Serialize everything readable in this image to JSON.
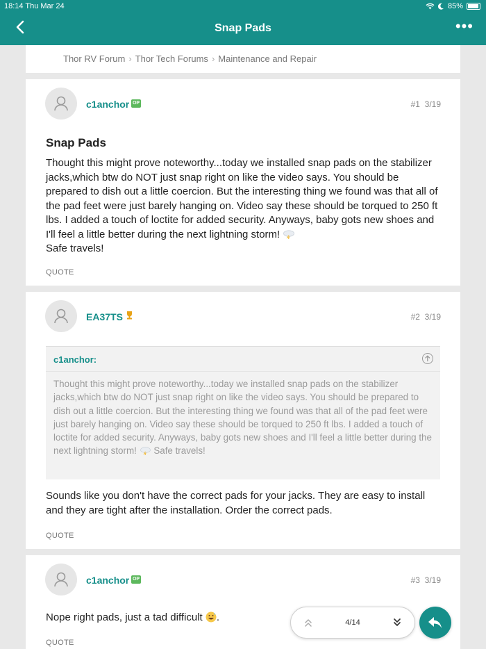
{
  "status": {
    "time_date": "18:14  Thu Mar 24",
    "battery": "85%"
  },
  "nav": {
    "title": "Snap Pads"
  },
  "breadcrumb": [
    "Thor RV Forum",
    "Thor Tech Forums",
    "Maintenance and Repair"
  ],
  "posts": [
    {
      "username": "c1anchor",
      "badge": "OP",
      "number": "#1",
      "date": "3/19",
      "title": "Snap Pads",
      "body": "Thought this might prove noteworthy...today we installed snap pads on the stabilizer jacks,which btw do NOT just snap right on like the video says. You should be prepared to dish out a little coercion. But the interesting thing we found was that all of the pad feet were just barely hanging on. Video say these should be torqued to 250 ft lbs. I added a touch of loctite for added security. Anyways, baby gots new shoes and I'll feel a little better during the next lightning storm!",
      "body_end": "Safe travels!",
      "quote_label": "QUOTE"
    },
    {
      "username": "EA37TS",
      "number": "#2",
      "date": "3/19",
      "quoted_user": "c1anchor:",
      "quoted_text": "Thought this might prove noteworthy...today we installed snap pads on the stabilizer jacks,which btw do NOT just snap right on like the video says. You should be prepared to dish out a little coercion. But the interesting thing we found was that all of the pad feet were just barely hanging on. Video say these should be torqued to 250 ft lbs. I added a touch of loctite for added security. Anyways, baby gots new shoes and I'll feel a little better during the next lightning storm!",
      "quoted_end": "Safe travels!",
      "body": "Sounds like you don't have the correct pads for your jacks. They are easy to install and they are tight after the installation. Order the correct pads.",
      "quote_label": "QUOTE"
    },
    {
      "username": "c1anchor",
      "badge": "OP",
      "number": "#3",
      "date": "3/19",
      "body": "Nope right pads, just a tad difficult",
      "body_end": ".",
      "quote_label": "QUOTE"
    }
  ],
  "pager": {
    "count": "4/14"
  },
  "colors": {
    "accent": "#168f8a",
    "badge": "#5cb85c"
  },
  "icons": [
    "back-chevron-icon",
    "more-dots-icon",
    "user-avatar-icon",
    "op-badge-icon",
    "trophy-icon",
    "storm-cloud-icon",
    "arrow-up-circle-icon",
    "double-chevron-up-icon",
    "double-chevron-down-icon",
    "reply-icon",
    "grinning-sweat-emoji-icon",
    "wifi-icon",
    "moon-icon",
    "battery-icon"
  ]
}
